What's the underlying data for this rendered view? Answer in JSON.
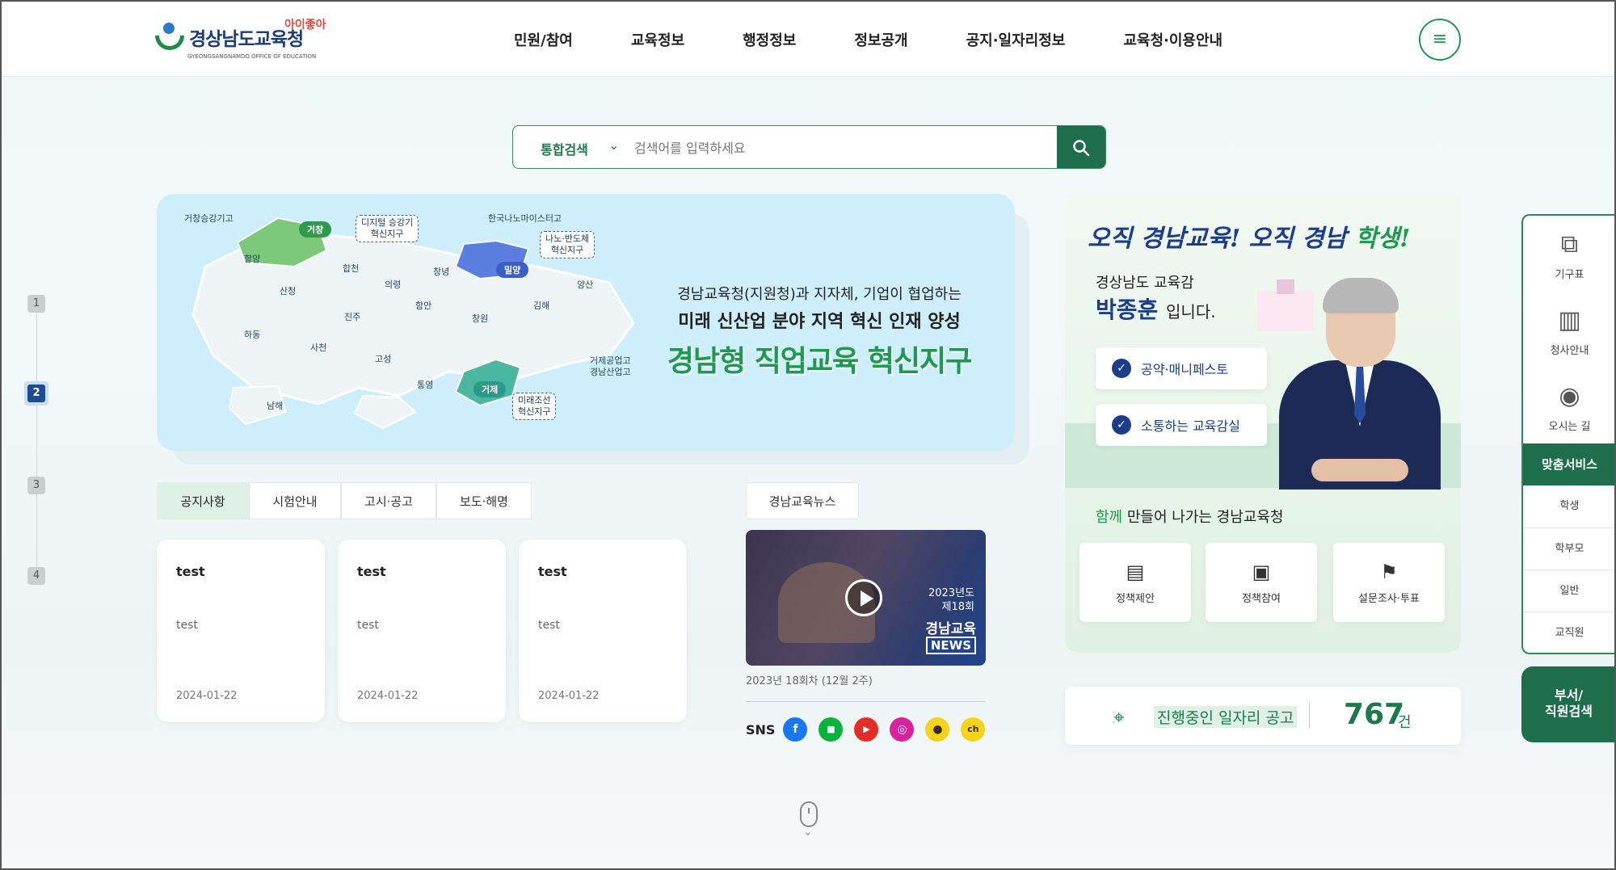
{
  "header": {
    "logo": {
      "text": "경상남도교육청",
      "sub": "GYEONGSANGNAMDO OFFICE OF EDUCATION",
      "slogan": "아이좋아"
    },
    "nav": [
      "민원/참여",
      "교육정보",
      "행정정보",
      "정보공개",
      "공지·일자리정보",
      "교육청·이용안내"
    ],
    "menu_icon": "hamburger-icon"
  },
  "search": {
    "scope": "통합검색",
    "placeholder": "검색어를 입력하세요",
    "button_icon": "search-icon"
  },
  "pager": {
    "pages": [
      "1",
      "2",
      "3",
      "4"
    ],
    "current": "2"
  },
  "banner": {
    "line1": "경남교육청(지원청)과 지자체, 기업이 협업하는",
    "line2": "미래 신산업 분야 지역 혁신 인재 양성",
    "line3": "경남형 직업교육 혁신지구",
    "map": {
      "school_geochang": "거창승강기고",
      "pin_geochang": "거창",
      "box_digital": [
        "디지털 승강기",
        "혁신지구"
      ],
      "school_nano": "한국나노마이스터고",
      "box_nano": [
        "나노·반도체",
        "혁신지구"
      ],
      "pin_miryang": "밀양",
      "school_geoje": [
        "거제공업고",
        "경남산업고"
      ],
      "pin_geoje": "거제",
      "box_shipbuild": [
        "미래조선",
        "혁신지구"
      ],
      "regions": [
        "함양",
        "합천",
        "의령",
        "창녕",
        "양산",
        "산청",
        "함안",
        "김해",
        "진주",
        "창원",
        "하동",
        "사천",
        "고성",
        "통영",
        "남해"
      ]
    }
  },
  "notice": {
    "tabs": [
      "공지사항",
      "시험안내",
      "고시·공고",
      "보도·해명"
    ],
    "active_tab": "공지사항",
    "cards": [
      {
        "title": "test",
        "body": "test",
        "date": "2024-01-22"
      },
      {
        "title": "test",
        "body": "test",
        "date": "2024-01-22"
      },
      {
        "title": "test",
        "body": "test",
        "date": "2024-01-22"
      }
    ]
  },
  "news": {
    "tab": "경남교육뉴스",
    "video": {
      "year": "2023년도",
      "edition": "제18회",
      "brand": "경남교육",
      "tag": "NEWS"
    },
    "caption": "2023년 18회차 (12월 2주)",
    "sns_label": "SNS",
    "sns": [
      {
        "name": "facebook-icon",
        "glyph": "f",
        "color": "#1877f2"
      },
      {
        "name": "line-icon",
        "glyph": "■",
        "color": "#06b33b"
      },
      {
        "name": "youtube-icon",
        "glyph": "▶",
        "color": "#e52d27"
      },
      {
        "name": "instagram-icon",
        "glyph": "◎",
        "color": "#d6249f"
      },
      {
        "name": "kakaotalk-icon",
        "glyph": "●",
        "color": "#f7d21a"
      },
      {
        "name": "kakaochannel-icon",
        "glyph": "ch",
        "color": "#f7d21a"
      }
    ]
  },
  "superintendent": {
    "slogan_part1": "오직 경남교육! 오직 경남",
    "slogan_part2": "학생!",
    "title": "경상남도 교육감",
    "name": "박종훈",
    "name_suffix": "입니다.",
    "links": [
      "공약·매니페스토",
      "소통하는 교육감실"
    ],
    "together_hl": "함께",
    "together": "만들어 나가는 경남교육청",
    "services": [
      {
        "icon": "document-icon",
        "glyph": "▤",
        "label": "정책제안"
      },
      {
        "icon": "book-icon",
        "glyph": "▣",
        "label": "정책참여"
      },
      {
        "icon": "flag-icon",
        "glyph": "⚑",
        "label": "설문조사·투표"
      }
    ]
  },
  "jobs": {
    "label": "진행중인 일자리 공고",
    "count": "767",
    "unit": "건"
  },
  "quick_menu": {
    "items": [
      {
        "icon": "org-chart-icon",
        "glyph": "⧉",
        "label": "기구표"
      },
      {
        "icon": "building-icon",
        "glyph": "▥",
        "label": "청사안내"
      },
      {
        "icon": "location-pin-icon",
        "glyph": "◉",
        "label": "오시는 길"
      }
    ],
    "custom_header": "맞춤서비스",
    "custom_items": [
      "학생",
      "학부모",
      "일반",
      "교직원"
    ],
    "dept_search": [
      "부서/",
      "직원검색"
    ]
  },
  "colors": {
    "brand_green": "#1e6e4d",
    "accent_green": "#1c9a4e",
    "navy": "#1b3d8a"
  }
}
